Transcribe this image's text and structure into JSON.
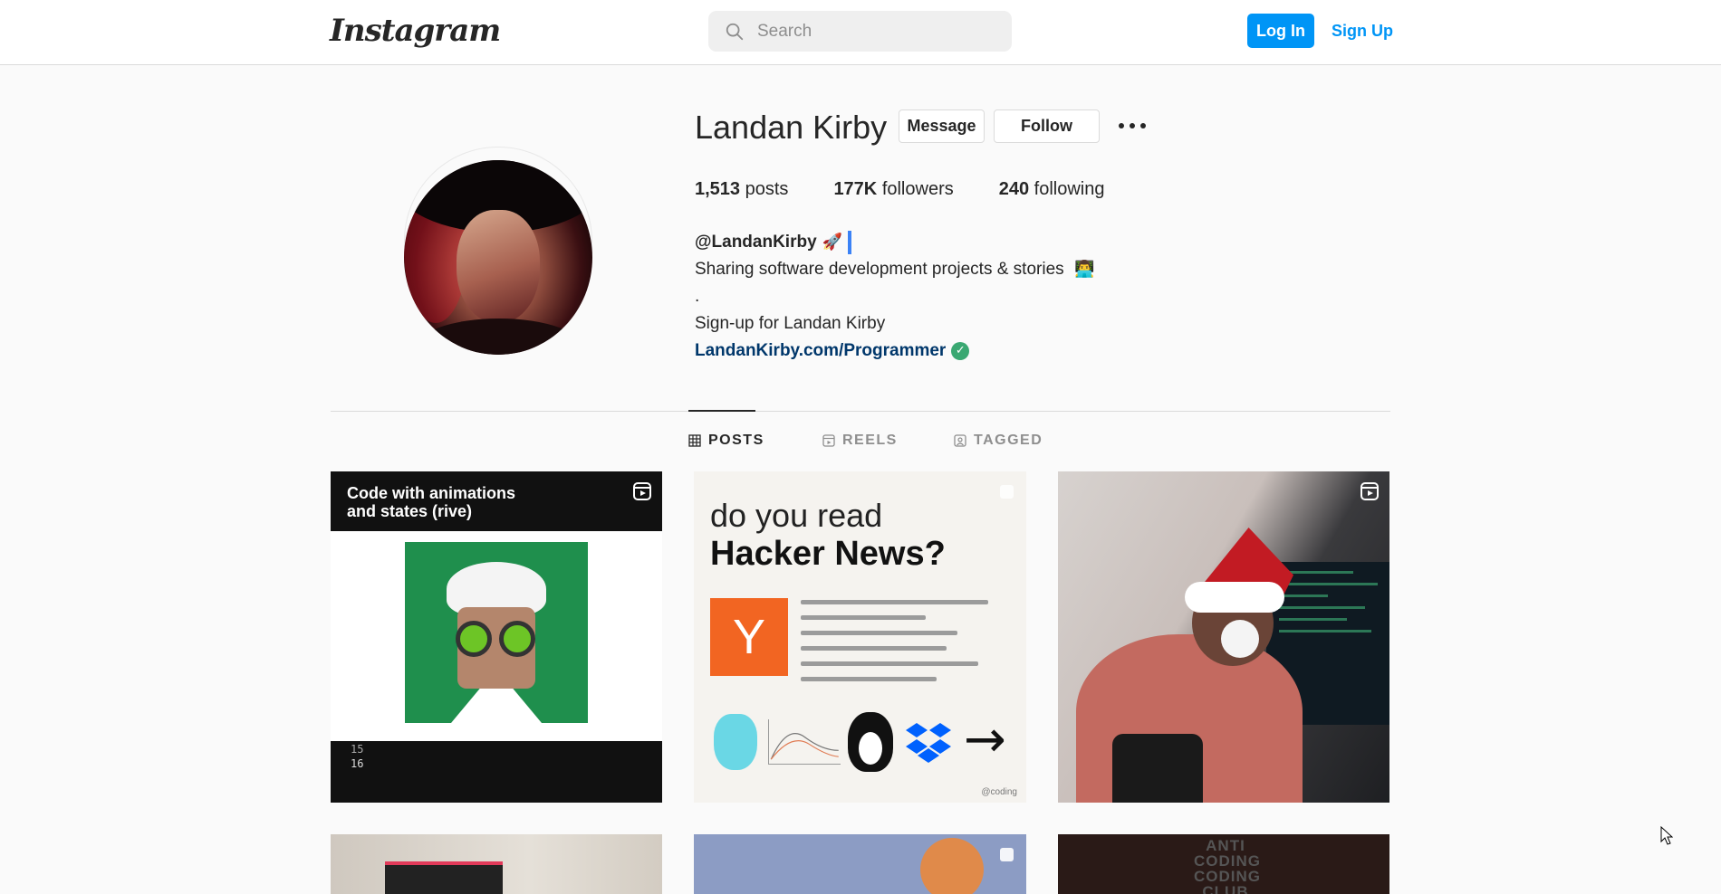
{
  "header": {
    "logo": "Instagram",
    "search_placeholder": "Search",
    "login_label": "Log In",
    "signup_label": "Sign Up"
  },
  "profile": {
    "name": "Landan Kirby",
    "message_label": "Message",
    "follow_label": "Follow",
    "stats": [
      {
        "value": "1,513",
        "label": "posts"
      },
      {
        "value": "177K",
        "label": "followers"
      },
      {
        "value": "240",
        "label": "following"
      }
    ],
    "bio": {
      "handle": "@LandanKirby",
      "line1": "Sharing software development projects & stories",
      "line2": ".",
      "line3": "Sign-up for Landan Kirby",
      "link": "LandanKirby.com/Programmer"
    }
  },
  "tabs": [
    {
      "label": "POSTS",
      "active": true
    },
    {
      "label": "REELS",
      "active": false
    },
    {
      "label": "TAGGED",
      "active": false
    }
  ],
  "posts": {
    "p1": {
      "title": "Code with animations and states (rive)",
      "line_a": "15",
      "line_b": "16"
    },
    "p2": {
      "line1": "do you read",
      "line2": "Hacker News?",
      "logo_letter": "Y",
      "credit": "@coding"
    },
    "p6": {
      "text": "ANTI CODING CODING CLUB"
    }
  },
  "colors": {
    "accent": "#0095f6",
    "link": "#00376b",
    "verified": "#3aa872"
  }
}
